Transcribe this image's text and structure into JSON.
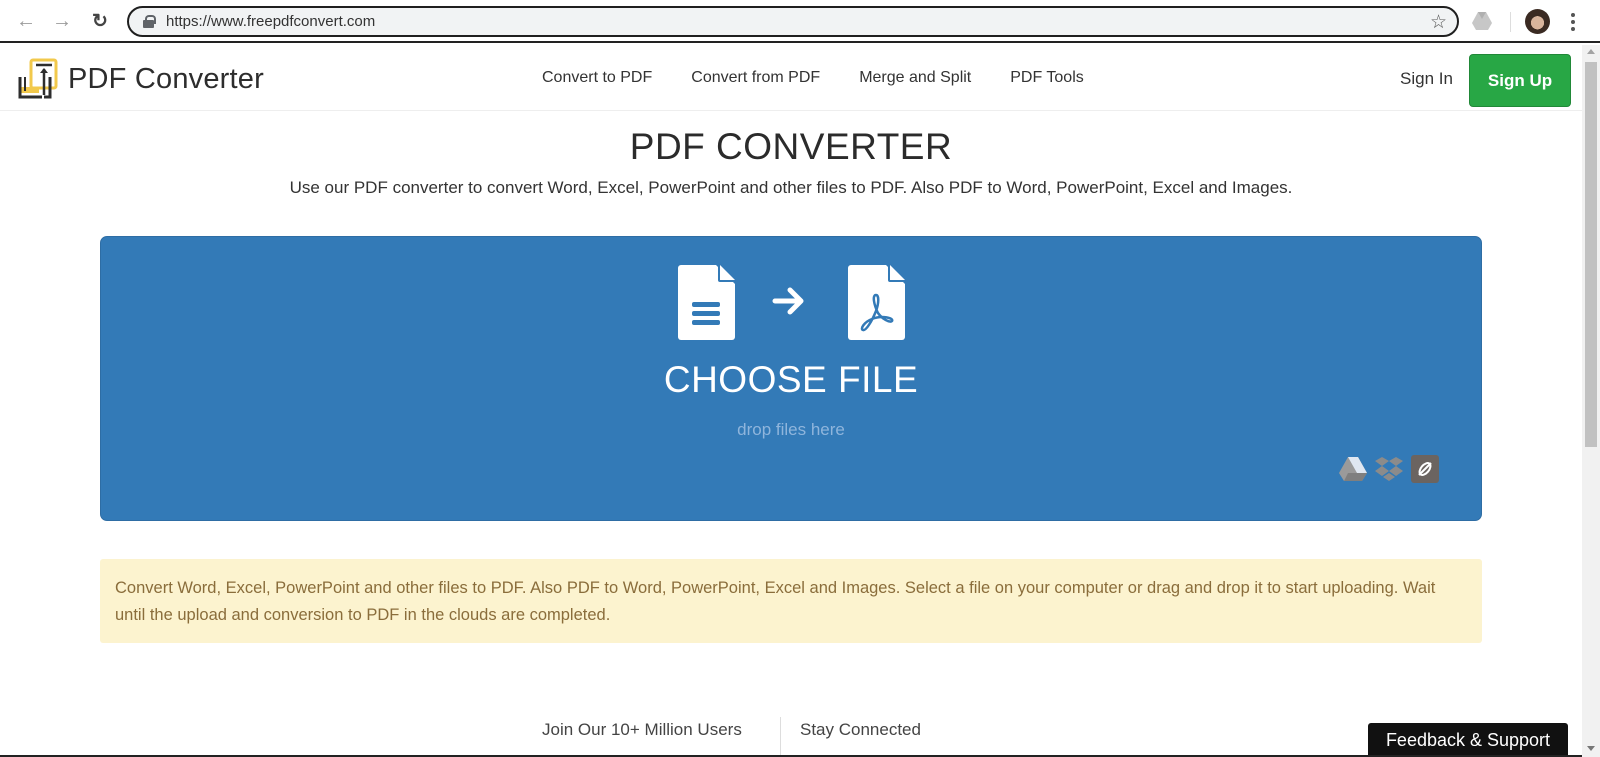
{
  "browser": {
    "url": "https://www.freepdfconvert.com",
    "icons": [
      "back-arrow-icon",
      "forward-arrow-icon",
      "reload-icon",
      "lock-icon",
      "bookmark-star-icon",
      "google-drive-extension-icon",
      "profile-avatar",
      "chrome-menu-icon"
    ],
    "back": "←",
    "forward": "→",
    "reload": "↻",
    "star": "☆"
  },
  "header": {
    "logo_text": "PDF Converter",
    "nav": [
      {
        "label": "Convert to PDF"
      },
      {
        "label": "Convert from PDF"
      },
      {
        "label": "Merge and Split"
      },
      {
        "label": "PDF Tools"
      }
    ],
    "sign_in": "Sign In",
    "sign_up": "Sign Up"
  },
  "hero": {
    "title": "PDF CONVERTER",
    "subtitle": "Use our PDF converter to convert Word, Excel, PowerPoint and other files to PDF. Also PDF to Word, PowerPoint, Excel and Images."
  },
  "drop_zone": {
    "choose_file": "CHOOSE FILE",
    "hint": "drop files here",
    "sources": [
      "google-drive",
      "dropbox",
      "url-link"
    ]
  },
  "info_banner": {
    "text": "Convert Word, Excel, PowerPoint and other files to PDF. Also PDF to Word, PowerPoint, Excel and Images. Select a file on your computer or drag and drop it to start uploading. Wait until the upload and conversion to PDF in the clouds are completed."
  },
  "footer": {
    "join_users": "Join Our 10+ Million Users",
    "stay_connected": "Stay Connected",
    "feedback": "Feedback & Support"
  },
  "colors": {
    "primary_blue": "#337ab7",
    "sign_up_green": "#28a745",
    "banner_bg": "#fcf3cf",
    "banner_text": "#8a6d3b",
    "logo_yellow": "#f2c94c"
  }
}
